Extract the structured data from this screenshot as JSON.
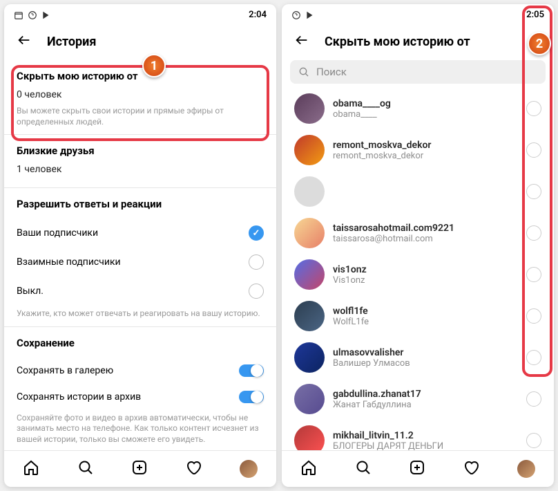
{
  "left": {
    "status_time": "2:04",
    "title": "История",
    "hide": {
      "title": "Скрыть мою историю от",
      "value": "0 человек",
      "desc": "Вы можете скрыть свои истории и прямые эфиры от определенных людей."
    },
    "close_friends": {
      "title": "Близкие друзья",
      "value": "1 человек"
    },
    "allow": {
      "title": "Разрешить ответы и реакции",
      "opt1": "Ваши подписчики",
      "opt2": "Взаимные подписчики",
      "opt3": "Выкл.",
      "desc": "Укажите, кто может отвечать и реагировать на вашу историю."
    },
    "saving": {
      "title": "Сохранение",
      "opt1": "Сохранять в галерею",
      "opt2": "Сохранять истории в архив",
      "desc": "Сохраняйте фото и видео в архив автоматически, чтобы не занимать место на телефоне. Как только контент исчезнет из вашей истории, только вы сможете его увидеть."
    }
  },
  "right": {
    "status_time": "2:05",
    "title": "Скрыть мою историю от",
    "search_placeholder": "Поиск",
    "users": [
      {
        "name": "obama____og",
        "sub": "obama____",
        "bg": "linear-gradient(135deg,#5a3c5a,#8b6d8b)"
      },
      {
        "name": "remont_moskva_dekor",
        "sub": "remont_moskva_dekor",
        "bg": "linear-gradient(135deg,#c0392b,#f39c12)"
      },
      {
        "name": "",
        "sub": "",
        "bg": "#dcdcdc"
      },
      {
        "name": "taissarosahotmail.com9221",
        "sub": "taissarosa@hotmail.com",
        "bg": "linear-gradient(135deg,#f7d794,#e77f67)"
      },
      {
        "name": "vis1onz",
        "sub": "Vis1onz",
        "bg": "linear-gradient(135deg,#546de5,#c44569)"
      },
      {
        "name": "wolfl1fe",
        "sub": "WolfL1fe",
        "bg": "linear-gradient(135deg,#2c3e50,#4b6584)"
      },
      {
        "name": "ulmasovvalisher",
        "sub": "Валишер Улмасов",
        "bg": "linear-gradient(135deg,#1e3799,#0c2461)"
      },
      {
        "name": "gabdullina.zhanat17",
        "sub": "Жанат Габдуллина",
        "bg": "linear-gradient(135deg,#786fa6,#574b90)"
      },
      {
        "name": "mikhail_litvin_11.2",
        "sub": "БЛОГЕРЫ ДАРЯТ ДЕНЬГИ",
        "bg": "linear-gradient(135deg,#b33939,#ff5252)"
      }
    ]
  }
}
